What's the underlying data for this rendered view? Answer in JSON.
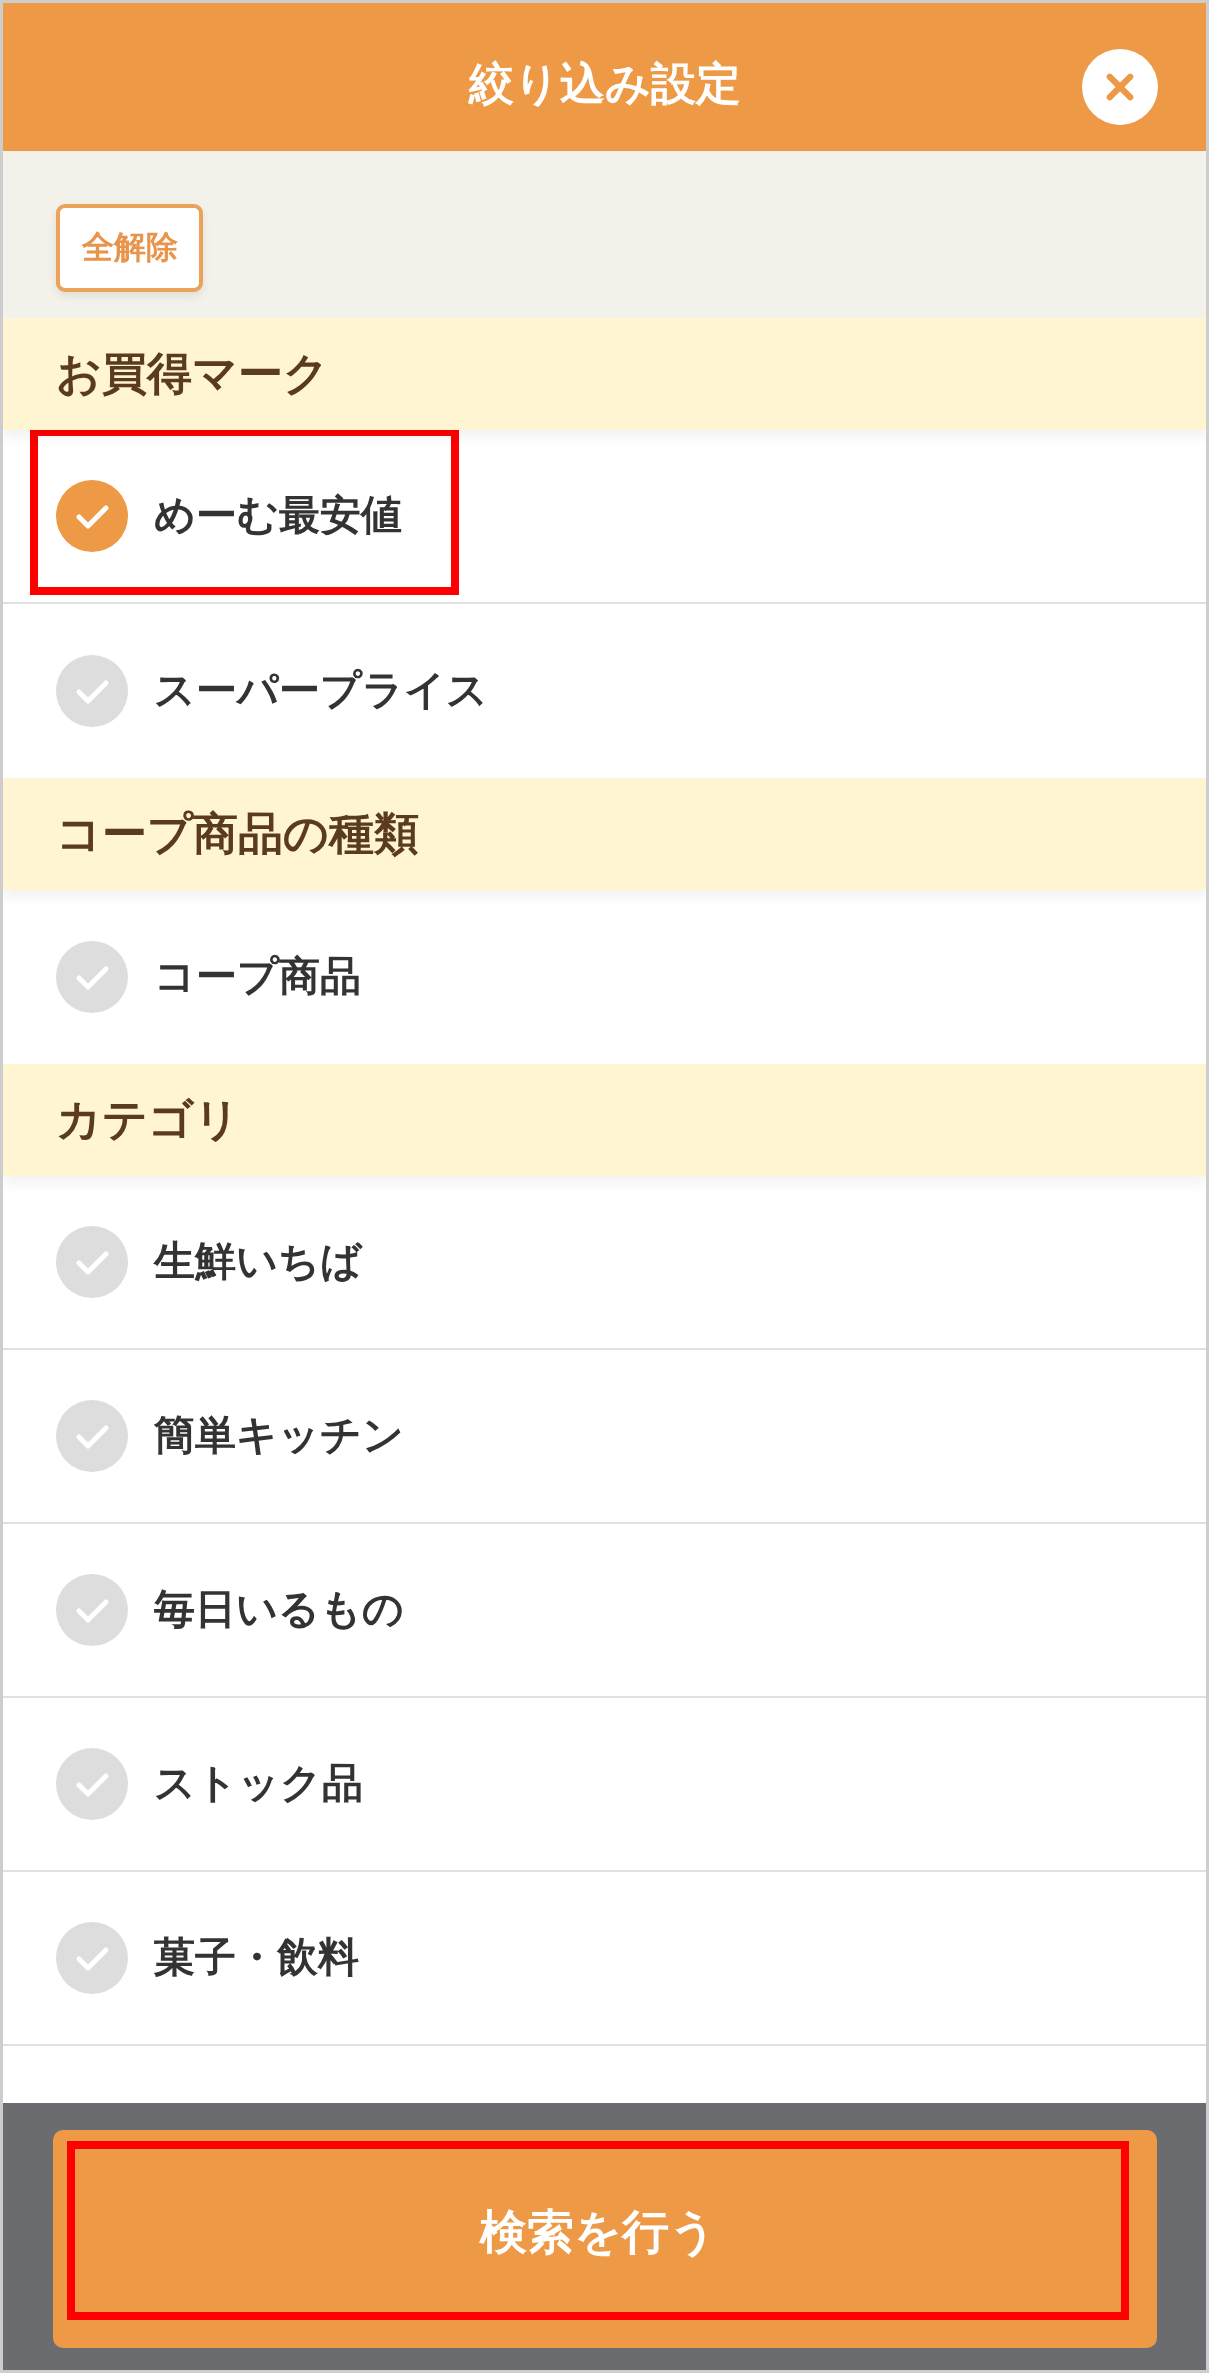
{
  "header": {
    "title": "絞り込み設定"
  },
  "toolbar": {
    "clear_all_button": "全解除"
  },
  "sections": [
    {
      "title": "お買得マーク",
      "items": [
        {
          "label": "めーむ最安値",
          "checked": true,
          "highlighted": true
        },
        {
          "label": "スーパープライス",
          "checked": false,
          "highlighted": false
        }
      ]
    },
    {
      "title": "コープ商品の種類",
      "items": [
        {
          "label": "コープ商品",
          "checked": false,
          "highlighted": false
        }
      ]
    },
    {
      "title": "カテゴリ",
      "items": [
        {
          "label": "生鮮いちば",
          "checked": false,
          "highlighted": false
        },
        {
          "label": "簡単キッチン",
          "checked": false,
          "highlighted": false
        },
        {
          "label": "毎日いるもの",
          "checked": false,
          "highlighted": false
        },
        {
          "label": "ストック品",
          "checked": false,
          "highlighted": false
        },
        {
          "label": "菓子・飲料",
          "checked": false,
          "highlighted": false
        }
      ]
    }
  ],
  "footer": {
    "search_button": {
      "label": "検索を行う",
      "highlighted": true
    }
  }
}
